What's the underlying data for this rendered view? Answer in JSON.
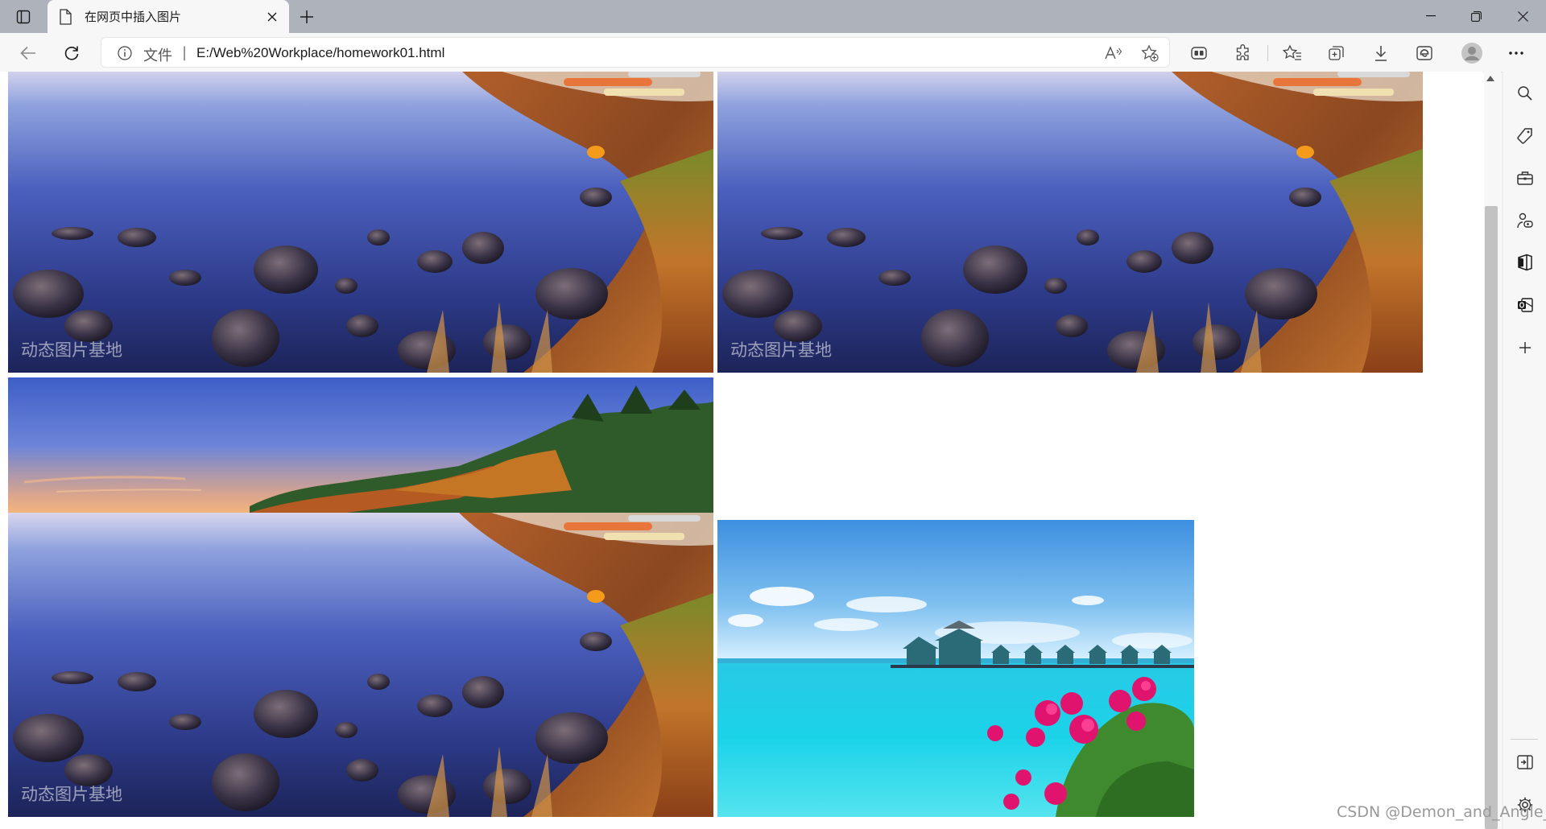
{
  "window": {
    "tab": {
      "title": "在网页中插入图片"
    },
    "new_tab_icon": "plus-icon",
    "controls": [
      "minimize-icon",
      "restore-icon",
      "close-icon"
    ]
  },
  "toolbar": {
    "scheme_label": "文件",
    "separator": "|",
    "url": "E:/Web%20Workplace/homework01.html",
    "buttons": [
      "back-icon",
      "refresh-icon",
      "read-aloud-icon",
      "add-favorite-icon",
      "collections-app-icon",
      "extensions-icon",
      "favorites-icon",
      "collections-icon",
      "downloads-icon",
      "browser-essentials-icon",
      "profile-icon",
      "more-icon"
    ]
  },
  "page": {
    "images": [
      {
        "watermark": "动态图片基地",
        "scene": "lake-shore-evening"
      },
      {
        "watermark": "动态图片基地",
        "scene": "lake-shore-evening"
      },
      {
        "watermark": "动态图片基地",
        "scene": "lake-shore-with-forest"
      },
      {
        "watermark": "",
        "scene": "tropical-sea-with-water-villas"
      }
    ],
    "footer_watermark": "CSDN @Demon_and_Angle_"
  },
  "sidebar": {
    "items": [
      "search-icon",
      "shopping-tag-icon",
      "tools-icon",
      "games-icon",
      "office-icon",
      "outlook-icon",
      "add-icon",
      "hide-sidebar-icon",
      "settings-icon"
    ]
  },
  "colors": {
    "titlebar": "#aeb3bb",
    "toolbar": "#f7f7f7",
    "lake_blue": "#3a4fa8",
    "autumn_orange": "#c0622a",
    "tropical_cyan": "#22c6e0"
  }
}
